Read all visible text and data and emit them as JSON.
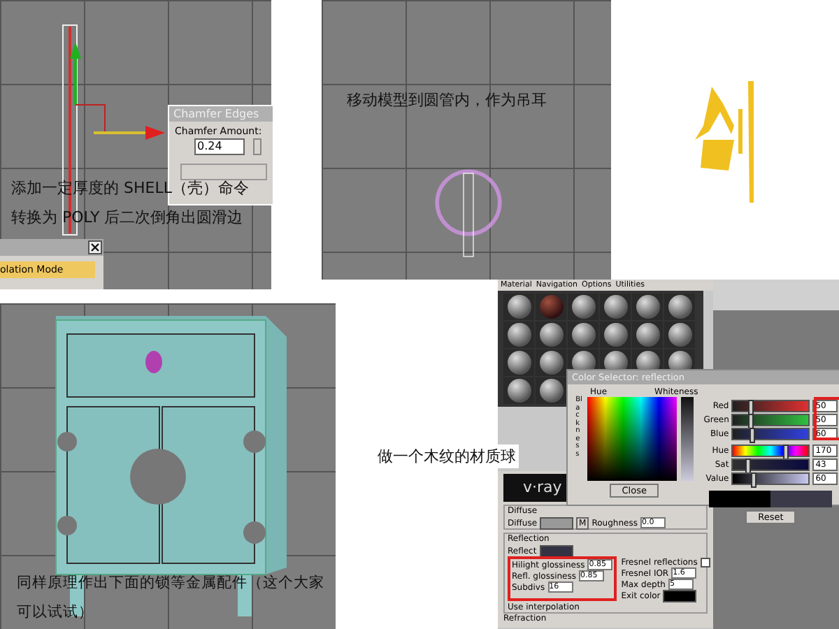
{
  "shell_step": {
    "dialog_title": "Chamfer Edges",
    "amount_label": "Chamfer Amount:",
    "amount_value": "0.24",
    "notes": [
      "添加一定厚度的 SHELL（壳）命令",
      "转换为 POLY 后二次倒角出圆滑边"
    ],
    "mode_item": "olation Mode"
  },
  "move_step": {
    "note": "移动模型到圆管内，作为吊耳"
  },
  "cabinet_step": {
    "note": "同样原理作出下面的锁等金属配件（这个大家可以试试）"
  },
  "material_step": {
    "note": "做一个木纹的材质球",
    "menu": [
      "Material",
      "Navigation",
      "Options",
      "Utilities"
    ],
    "color_selector": {
      "title": "Color Selector: reflection",
      "hue_label": "Hue",
      "whiteness_label": "Whiteness",
      "blackness_label": "Blackness",
      "close_button": "Close",
      "reset_button": "Reset",
      "channels": [
        {
          "kind": "red",
          "label": "Red",
          "value": "50",
          "level": 0.2
        },
        {
          "kind": "green",
          "label": "Green",
          "value": "50",
          "level": 0.2
        },
        {
          "kind": "blue",
          "label": "Blue",
          "value": "60",
          "level": 0.22
        },
        {
          "kind": "hue",
          "label": "Hue",
          "value": "170",
          "level": 0.66
        },
        {
          "kind": "sat",
          "label": "Sat",
          "value": "43",
          "level": 0.17
        },
        {
          "kind": "value",
          "label": "Value",
          "value": "60",
          "level": 0.24
        }
      ]
    },
    "vray": {
      "logo": "v·ray",
      "diffuse_group": "Diffuse",
      "diffuse_label": "Diffuse",
      "map_button": "M",
      "roughness_label": "Roughness",
      "roughness_value": "0.0",
      "reflection_group": "Reflection",
      "reflect_label": "Reflect",
      "params": [
        {
          "label": "Hilight glossiness",
          "value": "0.85"
        },
        {
          "label": "Refl. glossiness",
          "value": "0.85"
        },
        {
          "label": "Subdivs",
          "value": "16"
        }
      ],
      "fresnel_label": "Fresnel reflections",
      "fresnel_checked": false,
      "right_params": [
        {
          "label": "Fresnel IOR",
          "value": "1.6"
        },
        {
          "label": "Max depth",
          "value": "5"
        }
      ],
      "exit_label": "Exit color",
      "interp_label": "Use interpolation",
      "refraction_group": "Refraction"
    }
  }
}
